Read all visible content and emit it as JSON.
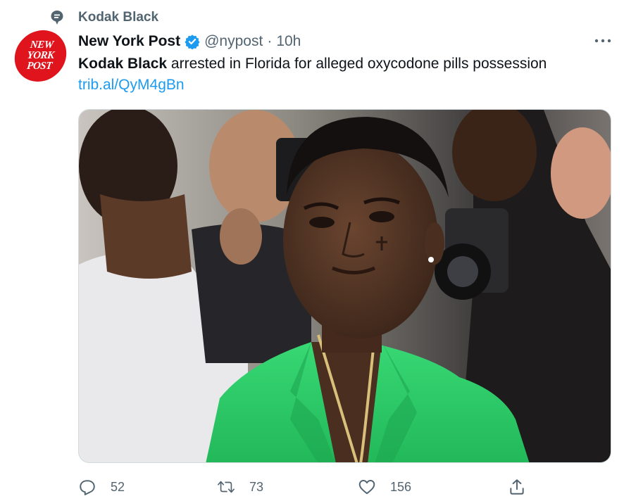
{
  "context": {
    "label": "Kodak Black",
    "icon": "topic-icon"
  },
  "author": {
    "name": "New York Post",
    "handle": "@nypost",
    "separator": "·",
    "time": "10h",
    "verified": true,
    "avatar_lines": [
      "NEW",
      "YORK",
      "POST"
    ],
    "avatar_color": "#e0141d"
  },
  "tweet": {
    "bold_lead": "Kodak Black",
    "text": " arrested in Florida for alleged oxycodone pills possession",
    "link": "trib.al/QyM4gBn",
    "link_color": "#1d9bf0"
  },
  "media": {
    "alt": "photo",
    "subject_jacket_color": "#2fd06a"
  },
  "actions": {
    "replies": "52",
    "retweets": "73",
    "likes": "156"
  },
  "colors": {
    "muted": "#536471",
    "accent": "#1d9bf0",
    "verified": "#1d9bf0"
  }
}
